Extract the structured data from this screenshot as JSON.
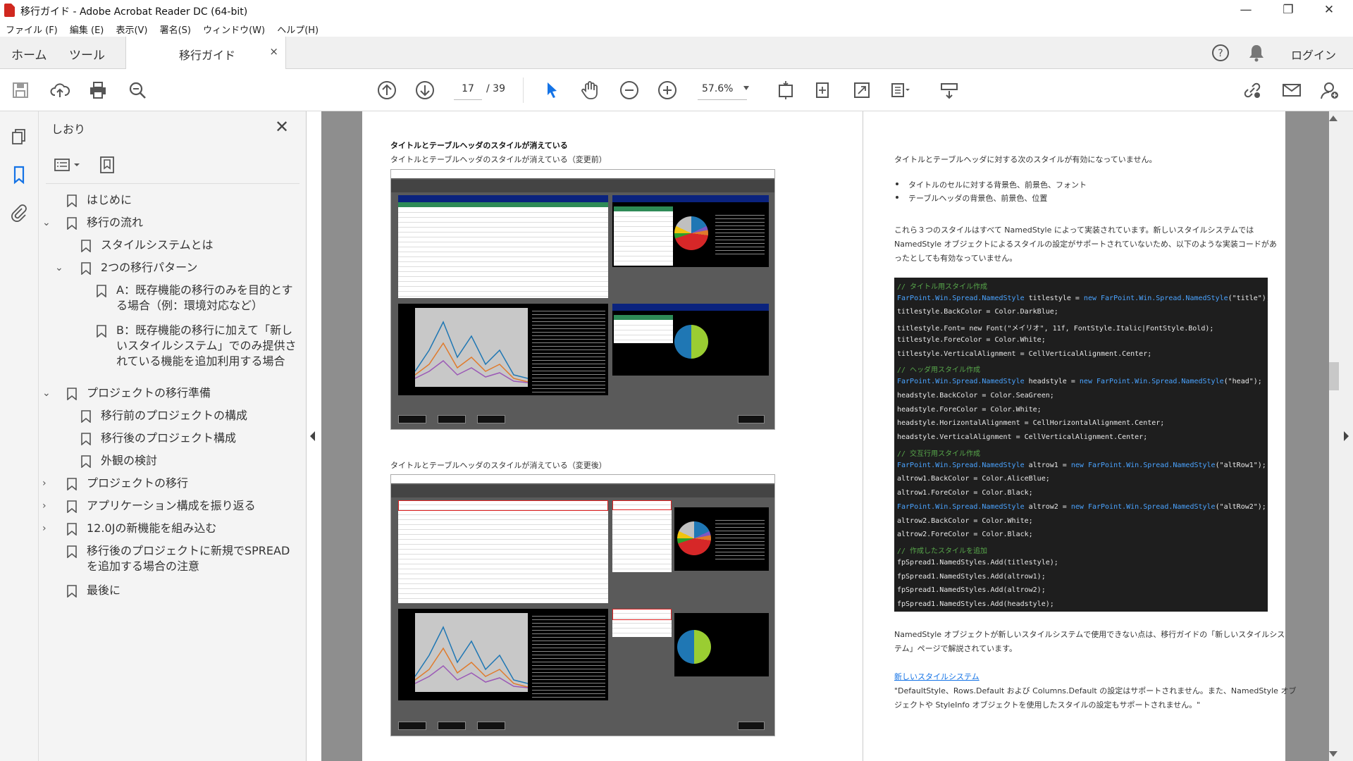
{
  "window": {
    "title": "移行ガイド - Adobe Acrobat Reader DC (64-bit)",
    "minimize": "—",
    "restore": "❐",
    "close": "✕"
  },
  "menu": [
    "ファイル (F)",
    "編集 (E)",
    "表示(V)",
    "署名(S)",
    "ウィンドウ(W)",
    "ヘルプ(H)"
  ],
  "tabs": {
    "home": "ホーム",
    "tools": "ツール",
    "document": "移行ガイド",
    "close": "×",
    "login": "ログイン"
  },
  "toolbar": {
    "page_current": "17",
    "page_total": "/ 39",
    "zoom": "57.6%"
  },
  "sidebar": {
    "title": "しおり",
    "close": "✕",
    "bookmarks": [
      {
        "label": "はじめに",
        "level": 0,
        "arrow": ""
      },
      {
        "label": "移行の流れ",
        "level": 0,
        "arrow": "v"
      },
      {
        "label": "スタイルシステムとは",
        "level": 1,
        "arrow": ""
      },
      {
        "label": "2つの移行パターン",
        "level": 1,
        "arrow": "v"
      },
      {
        "label": "A：既存機能の移行のみを目的とする場合（例：環境対応など）",
        "level": 2,
        "arrow": ""
      },
      {
        "label": "B：既存機能の移行に加えて「新しいスタイルシステム」でのみ提供されている機能を追加利用する場合",
        "level": 2,
        "arrow": ""
      },
      {
        "label": "プロジェクトの移行準備",
        "level": 0,
        "arrow": "v"
      },
      {
        "label": "移行前のプロジェクトの構成",
        "level": 1,
        "arrow": ""
      },
      {
        "label": "移行後のプロジェクト構成",
        "level": 1,
        "arrow": ""
      },
      {
        "label": "外観の検討",
        "level": 1,
        "arrow": ""
      },
      {
        "label": "プロジェクトの移行",
        "level": 0,
        "arrow": ">"
      },
      {
        "label": "アプリケーション構成を振り返る",
        "level": 0,
        "arrow": ">"
      },
      {
        "label": "12.0Jの新機能を組み込む",
        "level": 0,
        "arrow": ">"
      },
      {
        "label": "移行後のプロジェクトに新規でSPREADを追加する場合の注意",
        "level": 0,
        "arrow": ""
      },
      {
        "label": "最後に",
        "level": 0,
        "arrow": ""
      }
    ]
  },
  "doc": {
    "left": {
      "heading": "タイトルとテーブルヘッダのスタイルが消えている",
      "caption_before": "タイトルとテーブルヘッダのスタイルが消えている（変更前）",
      "caption_after": "タイトルとテーブルヘッダのスタイルが消えている（変更後）"
    },
    "right": {
      "intro": "タイトルとテーブルヘッダに対する次のスタイルが有効になっていません。",
      "bullets": [
        "タイトルのセルに対する背景色、前景色、フォント",
        "テーブルヘッダの背景色、前景色、位置"
      ],
      "para1": "これら３つのスタイルはすべて NamedStyle によって実装されています。新しいスタイルシステムでは",
      "para2": "NamedStyle オブジェクトによるスタイルの設定がサポートされていないため、以下のような実装コードがあ",
      "para3": "ったとしても有効なっていません。",
      "after1": "NamedStyle オブジェクトが新しいスタイルシステムで使用できない点は、移行ガイドの「新しいスタイルシス",
      "after2": "テム」ページで解説されています。",
      "link": "新しいスタイルシステム",
      "quote1": "\"DefaultStyle、Rows.Default および Columns.Default の設定はサポートされません。また、NamedStyle オブ",
      "quote2": "ジェクトや StyleInfo オブジェクトを使用したスタイルの設定もサポートされません。\""
    },
    "code": [
      {
        "t": "// タイトル用スタイル作成",
        "c": "cmt"
      },
      {
        "t": "FarPoint.Win.Spread.NamedStyle titlestyle = new FarPoint.Win.Spread.NamedStyle(\"title\");",
        "c": "cwt"
      },
      {
        "t": "titlestyle.BackColor = Color.DarkBlue;",
        "c": "cwt"
      },
      {
        "t": "titlestyle.Font= new Font(\"メイリオ\", 11f, FontStyle.Italic|FontStyle.Bold);",
        "c": "cwt"
      },
      {
        "t": "titlestyle.ForeColor = Color.White;",
        "c": "cwt"
      },
      {
        "t": "titlestyle.VerticalAlignment = CellVerticalAlignment.Center;",
        "c": "cwt"
      },
      {
        "t": "// ヘッダ用スタイル作成",
        "c": "cmt"
      },
      {
        "t": "FarPoint.Win.Spread.NamedStyle headstyle = new FarPoint.Win.Spread.NamedStyle(\"head\");",
        "c": "cwt"
      },
      {
        "t": "headstyle.BackColor = Color.SeaGreen;",
        "c": "cwt"
      },
      {
        "t": "headstyle.ForeColor = Color.White;",
        "c": "cwt"
      },
      {
        "t": "headstyle.HorizontalAlignment = CellHorizontalAlignment.Center;",
        "c": "cwt"
      },
      {
        "t": "headstyle.VerticalAlignment = CellVerticalAlignment.Center;",
        "c": "cwt"
      },
      {
        "t": "// 交互行用スタイル作成",
        "c": "cmt"
      },
      {
        "t": "FarPoint.Win.Spread.NamedStyle altrow1 = new FarPoint.Win.Spread.NamedStyle(\"altRow1\");",
        "c": "cwt"
      },
      {
        "t": "altrow1.BackColor = Color.AliceBlue;",
        "c": "cwt"
      },
      {
        "t": "altrow1.ForeColor = Color.Black;",
        "c": "cwt"
      },
      {
        "t": "FarPoint.Win.Spread.NamedStyle altrow2 = new FarPoint.Win.Spread.NamedStyle(\"altRow2\");",
        "c": "cwt"
      },
      {
        "t": "altrow2.BackColor = Color.White;",
        "c": "cwt"
      },
      {
        "t": "altrow2.ForeColor = Color.Black;",
        "c": "cwt"
      },
      {
        "t": "// 作成したスタイルを追加",
        "c": "cmt"
      },
      {
        "t": "fpSpread1.NamedStyles.Add(titlestyle);",
        "c": "cwt"
      },
      {
        "t": "fpSpread1.NamedStyles.Add(altrow1);",
        "c": "cwt"
      },
      {
        "t": "fpSpread1.NamedStyles.Add(altrow2);",
        "c": "cwt"
      },
      {
        "t": "fpSpread1.NamedStyles.Add(headstyle);",
        "c": "cwt"
      }
    ]
  },
  "colors": {
    "accent": "#1473e6",
    "code_bg": "#1e1e1e",
    "comment": "#57a64a",
    "keyword": "#4aa3ff",
    "link": "#1473e6"
  }
}
